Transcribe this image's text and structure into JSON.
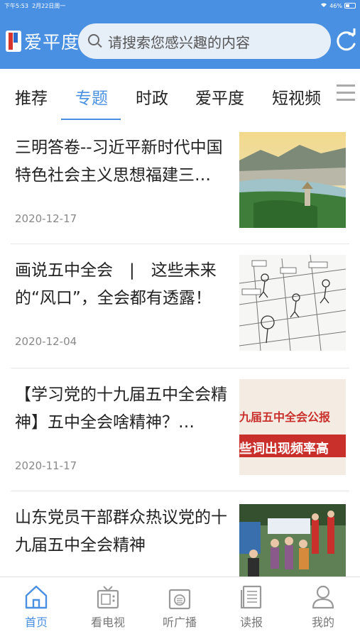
{
  "status": {
    "time": "下午5:53",
    "date": "2月22日周一",
    "battery": "46%"
  },
  "header": {
    "app_name": "爱平度",
    "search_placeholder": "请搜索您感兴趣的内容"
  },
  "tabs": [
    {
      "label": "推荐",
      "active": false
    },
    {
      "label": "专题",
      "active": true
    },
    {
      "label": "时政",
      "active": false
    },
    {
      "label": "爱平度",
      "active": false
    },
    {
      "label": "短视频",
      "active": false
    }
  ],
  "articles": [
    {
      "title": "三明答卷--习近平新时代中国特色社会主义思想福建三…",
      "date": "2020-12-17",
      "thumb": "landscape"
    },
    {
      "title": "画说五中全会　|　这些未来的“风口”，全会都有透露！",
      "date": "2020-12-04",
      "thumb": "sketch"
    },
    {
      "title": "【学习党的十九届五中全会精神】五中全会啥精神？…",
      "date": "2020-11-17",
      "thumb": "banner",
      "thumb_text": [
        "九届五中全会公报",
        "些词出现频率高"
      ]
    },
    {
      "title": "山东党员干部群众热议党的十九届五中全会精神",
      "date": "",
      "thumb": "people"
    }
  ],
  "bottom_nav": [
    {
      "label": "首页",
      "icon": "home-icon",
      "active": true
    },
    {
      "label": "看电视",
      "icon": "tv-icon",
      "active": false
    },
    {
      "label": "听广播",
      "icon": "radio-icon",
      "active": false
    },
    {
      "label": "读报",
      "icon": "newspaper-icon",
      "active": false
    },
    {
      "label": "我的",
      "icon": "user-icon",
      "active": false
    }
  ],
  "colors": {
    "brand": "#4a90e2",
    "text": "#222222",
    "muted": "#888888"
  }
}
